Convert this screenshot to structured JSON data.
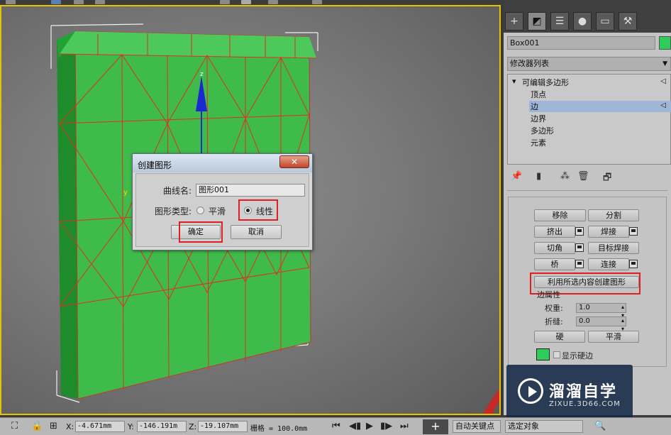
{
  "viewport": {
    "axis_label": "z",
    "y_label": "y"
  },
  "dialog": {
    "title": "创建图形",
    "close_label": "✕",
    "curve_name_label": "曲线名:",
    "curve_name_value": "图形001",
    "shape_type_label": "图形类型:",
    "option_smooth": "平滑",
    "option_linear": "线性",
    "selected_option": "线性",
    "ok_label": "确定",
    "cancel_label": "取消"
  },
  "panel": {
    "object_name": "Box001",
    "object_color": "#2ecc5a",
    "modifier_list": "修改器列表",
    "stack": {
      "root": "可编辑多边形",
      "items": [
        "顶点",
        "边",
        "边界",
        "多边形",
        "元素"
      ],
      "selected": "边"
    },
    "buttons": {
      "remove": "移除",
      "split": "分割",
      "extrude": "挤出",
      "weld": "焊接",
      "chamfer": "切角",
      "target_weld": "目标焊接",
      "bridge": "桥",
      "connect": "连接",
      "create_shape": "利用所选内容创建图形",
      "hard": "硬",
      "smooth": "平滑"
    },
    "edge_props_label": "边属性",
    "weight_label": "权重:",
    "weight_value": "1.0",
    "crease_label": "折缝:",
    "crease_value": "0.0",
    "show_hard_edges": "显示硬边"
  },
  "statusbar": {
    "x_label": "X:",
    "x_value": "-4.671mm",
    "y_label": "Y:",
    "y_value": "-146.191m",
    "z_label": "Z:",
    "z_value": "-19.107mm",
    "grid_label": "栅格 = 100.0mm",
    "auto_key": "自动关键点",
    "selected_objects": "选定对象"
  },
  "watermark": {
    "brand": "溜溜自学",
    "url": "ZIXUE.3D66.COM"
  }
}
